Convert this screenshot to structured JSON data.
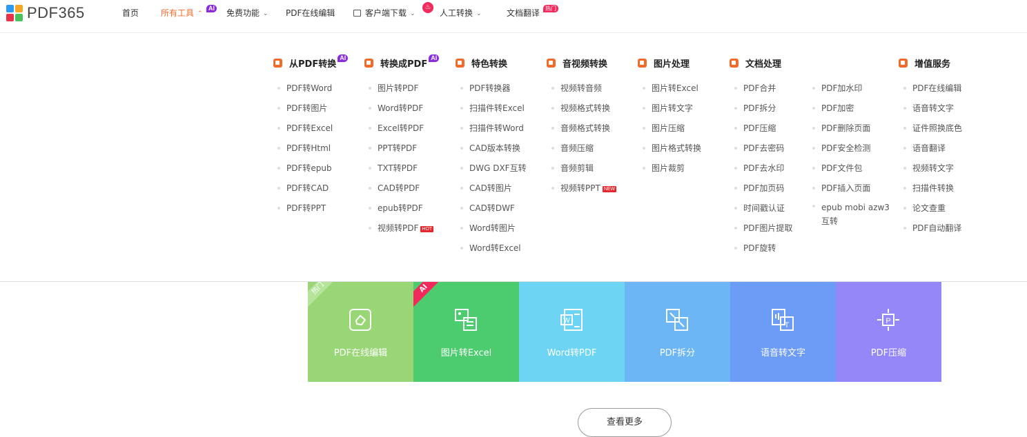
{
  "header": {
    "logo_text": "PDF365",
    "nav": [
      {
        "label": "首页"
      },
      {
        "label": "所有工具",
        "badge": "AI"
      },
      {
        "label": "免费功能"
      },
      {
        "label": "PDF在线编辑"
      },
      {
        "label": "客户端下载"
      },
      {
        "label": "人工转换"
      },
      {
        "label": "文档翻译",
        "badge": "热门"
      }
    ]
  },
  "menu": {
    "columns": [
      {
        "title": "从PDF转换",
        "badge": "AI",
        "items": [
          "PDF转Word",
          "PDF转图片",
          "PDF转Excel",
          "PDF转Html",
          "PDF转epub",
          "PDF转CAD",
          "PDF转PPT"
        ]
      },
      {
        "title": "转换成PDF",
        "badge": "AI",
        "items": [
          "图片转PDF",
          "Word转PDF",
          "Excel转PDF",
          "PPT转PDF",
          "TXT转PDF",
          "CAD转PDF",
          "epub转PDF",
          "视频转PDF"
        ],
        "tag_item": {
          "index": 7,
          "tag": "HOT"
        }
      },
      {
        "title": "特色转换",
        "items": [
          "PDF转换器",
          "扫描件转Excel",
          "扫描件转Word",
          "CAD版本转换",
          "DWG DXF互转",
          "CAD转图片",
          "CAD转DWF",
          "Word转图片",
          "Word转Excel"
        ]
      },
      {
        "title": "音视频转换",
        "items": [
          "视频转音频",
          "视频格式转换",
          "音频格式转换",
          "音频压缩",
          "音频剪辑",
          "视频转PPT"
        ],
        "tag_item": {
          "index": 5,
          "tag": "NEW"
        }
      },
      {
        "title": "图片处理",
        "items": [
          "图片转Excel",
          "图片转文字",
          "图片压缩",
          "图片格式转换",
          "图片裁剪"
        ]
      },
      {
        "title": "文档处理",
        "items": [
          "PDF合并",
          "PDF拆分",
          "PDF压缩",
          "PDF去密码",
          "PDF去水印",
          "PDF加页码",
          "时间戳认证",
          "PDF图片提取",
          "PDF旋转"
        ],
        "items2": [
          "PDF加水印",
          "PDF加密",
          "PDF删除页面",
          "PDF安全检测",
          "PDF文件包",
          "PDF插入页面",
          "epub mobi azw3互转"
        ]
      },
      {
        "title": "增值服务",
        "items": [
          "PDF在线编辑",
          "语音转文字",
          "证件照换底色",
          "语音翻译",
          "视频转文字",
          "扫描件转换",
          "论文查重",
          "PDF自动翻译"
        ]
      }
    ]
  },
  "tiles": [
    {
      "label": "PDF在线编辑",
      "color": "#99d776",
      "ribbon": "热门",
      "ribbon_color": "#b5e49a"
    },
    {
      "label": "图片转Excel",
      "color": "#4dcc6f",
      "ribbon": "AI",
      "ribbon_color": "#f2295b"
    },
    {
      "label": "Word转PDF",
      "color": "#6dd5f3"
    },
    {
      "label": "PDF拆分",
      "color": "#6cb6f6"
    },
    {
      "label": "语音转文字",
      "color": "#6d9cf6"
    },
    {
      "label": "PDF压缩",
      "color": "#9487f8"
    }
  ],
  "more_button": "查看更多",
  "colors": {
    "accent": "#f26b2a",
    "ai_badge": "#8a2be2",
    "hot_badge": "#f2295b"
  }
}
